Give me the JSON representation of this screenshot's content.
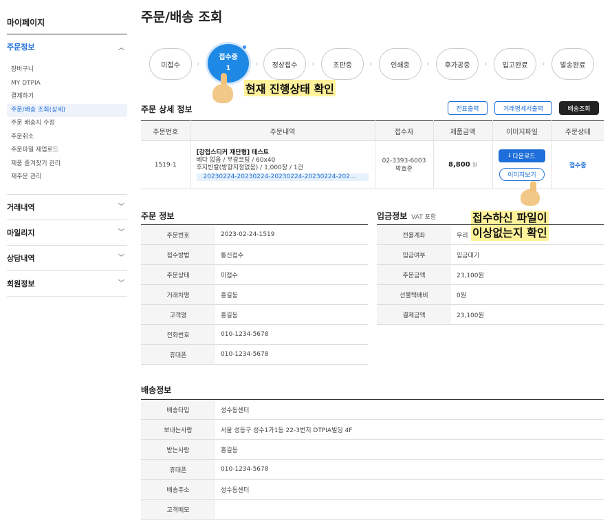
{
  "sidebar": {
    "title": "마이페이지",
    "active_section": "주문정보",
    "items": [
      "장바구니",
      "MY DTPIA",
      "결제하기",
      "주문/배송 조회(상세)",
      "주문 배송지 수정",
      "주문취소",
      "주문파일 재업로드",
      "제품 즐겨찾기 관리",
      "재주문 관리"
    ],
    "sections": [
      "거래내역",
      "마일리지",
      "상담내역",
      "회원정보"
    ]
  },
  "page_title": "주문/배송 조회",
  "steps": [
    "미접수",
    "접수중",
    "정상접수",
    "조판중",
    "인쇄중",
    "후가공중",
    "입고완료",
    "발송완료"
  ],
  "current_step_count": "1",
  "callouts": {
    "status": "현재 진행상태 확인",
    "file_line1": "접수하신 파일이",
    "file_line2": "이상없는지 확인"
  },
  "order_detail": {
    "title": "주문 상세 정보",
    "buttons": [
      "전표출력",
      "거래명세서출력",
      "배송조회"
    ],
    "headers": [
      "주문번호",
      "주문내역",
      "접수자",
      "제품금액",
      "이미지파일",
      "주문상태"
    ],
    "row": {
      "order_no": "1519-1",
      "product_name": "[강접스티커 재단형] 테스트",
      "line1": "베다 없음 / 무광코팅 / 60x40",
      "line2": "후지반칼(방향지정없음) / 1,000장 / 1건",
      "files": "20230224-20230224-20230224-20230224-202...",
      "phone": "02-3393-6003",
      "receiver": "박효준",
      "price": "8,800",
      "price_unit": "원",
      "download": "다운로드",
      "view": "이미지보기",
      "status": "접수중"
    }
  },
  "order_info": {
    "title": "주문 정보",
    "rows": [
      {
        "k": "주문번호",
        "v": "2023-02-24-1519"
      },
      {
        "k": "접수방법",
        "v": "통신접수"
      },
      {
        "k": "주문상태",
        "v": "미접수"
      },
      {
        "k": "거래처명",
        "v": "홍길동"
      },
      {
        "k": "고객명",
        "v": "홍길동"
      },
      {
        "k": "전화번호",
        "v": "010-1234-5678"
      },
      {
        "k": "휴대폰",
        "v": "010-1234-5678"
      }
    ]
  },
  "payment_info": {
    "title": "입금정보",
    "vat": "VAT 포함",
    "rows": [
      {
        "k": "전용계좌",
        "v": "우리"
      },
      {
        "k": "입금여부",
        "v": "입금대기"
      },
      {
        "k": "주문금액",
        "v": "23,100원"
      },
      {
        "k": "선불택배비",
        "v": "0원"
      },
      {
        "k": "결제금액",
        "v": "23,100원"
      }
    ]
  },
  "shipping_info": {
    "title": "배송정보",
    "rows": [
      {
        "k": "배송타입",
        "v": "성수동센터"
      },
      {
        "k": "보내는사람",
        "v": "서울 성동구 성수1가1동 22-3번지 DTPIA빌딩 4F"
      },
      {
        "k": "받는사람",
        "v": "홍길동"
      },
      {
        "k": "휴대폰",
        "v": "010-1234-5678"
      },
      {
        "k": "배송주소",
        "v": "성수동센터"
      },
      {
        "k": "고객메모",
        "v": ""
      }
    ]
  },
  "colors": {
    "accent": "#1e6fd9",
    "current_step": "#1e88e5",
    "highlight": "#fff29a",
    "alert": "#e0323a"
  }
}
